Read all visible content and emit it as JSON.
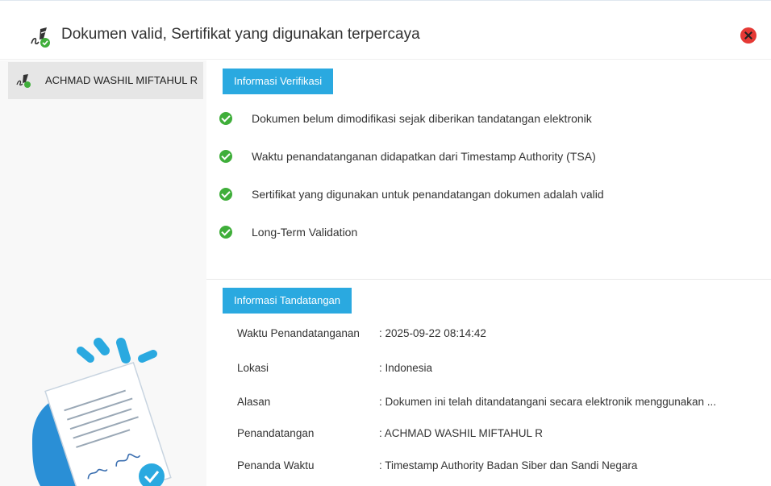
{
  "header": {
    "title": "Dokumen valid, Sertifikat yang digunakan terpercaya"
  },
  "sidebar": {
    "items": [
      {
        "label": "ACHMAD WASHIL MIFTAHUL R"
      }
    ]
  },
  "verification": {
    "tab_label": "Informasi Verifikasi",
    "checks": [
      {
        "text": "Dokumen belum dimodifikasi sejak diberikan tandatangan elektronik"
      },
      {
        "text": "Waktu penandatanganan didapatkan dari Timestamp Authority (TSA)"
      },
      {
        "text": "Sertifikat yang digunakan untuk penandatangan dokumen adalah valid"
      },
      {
        "text": "Long-Term Validation"
      }
    ]
  },
  "signature": {
    "tab_label": "Informasi Tandatangan",
    "rows": [
      {
        "key": "Waktu Penandatanganan",
        "value": ": 2025-09-22 08:14:42"
      },
      {
        "key": "Lokasi",
        "value": ": Indonesia"
      },
      {
        "key": "Alasan",
        "value": ": Dokumen ini telah ditandatangani secara elektronik menggunakan ..."
      },
      {
        "key": "Penandatangan",
        "value": ": ACHMAD WASHIL MIFTAHUL R"
      },
      {
        "key": "Penanda Waktu",
        "value": ": Timestamp Authority Badan Siber dan Sandi Negara"
      }
    ]
  },
  "colors": {
    "accent": "#2aa9e0",
    "success": "#3fae3a",
    "close": "#e53935"
  },
  "icons": {
    "header": "signature-valid-icon",
    "close": "close-icon",
    "check": "check-circle-icon"
  }
}
